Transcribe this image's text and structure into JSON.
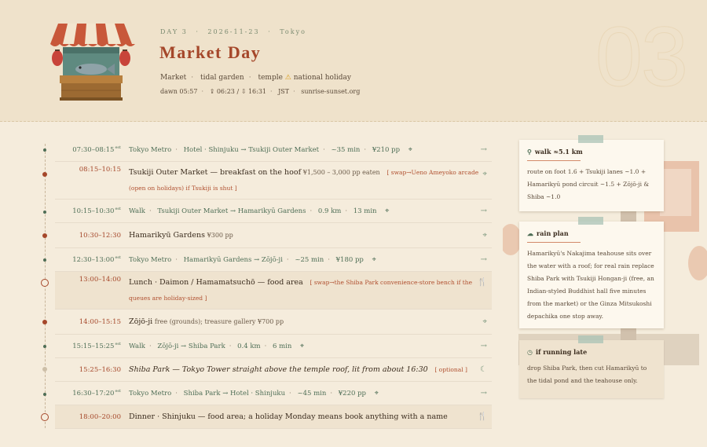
{
  "header": {
    "day_label": "DAY 3",
    "date": "2026-11-23",
    "city": "Tokyo",
    "title": "Market Day",
    "tags": [
      "Market",
      "tidal garden",
      "temple"
    ],
    "holiday_tag": "national holiday",
    "dawn": "dawn 05:57",
    "sunrise": "06:23",
    "sunset": "16:31",
    "tz": "JST",
    "source": "sunrise-sunset.org",
    "day_number": "03"
  },
  "timeline": [
    {
      "kind": "transit",
      "time": "07:30–08:15",
      "tz": "est",
      "mode": "Tokyo Metro",
      "route": "Hotel · Shinjuku → Tsukiji Outer Market",
      "duration": "~35 min",
      "cost": "¥210 pp"
    },
    {
      "kind": "visit",
      "time": "08:15–10:15",
      "title": "Tsukiji Outer Market — breakfast on the hoof",
      "detail": "¥1,500 – 3,000 pp eaten",
      "swap": "[ swap→Ueno Ameyoko arcade (open on holidays) if Tsukiji is shut ]"
    },
    {
      "kind": "transit",
      "time": "10:15–10:30",
      "tz": "est",
      "mode": "Walk",
      "route": "Tsukiji Outer Market → Hamarikyū Gardens",
      "distance": "0.9 km",
      "duration": "13 min"
    },
    {
      "kind": "visit",
      "time": "10:30–12:30",
      "title": "Hamarikyū Gardens",
      "detail": "¥300 pp"
    },
    {
      "kind": "transit",
      "time": "12:30–13:00",
      "tz": "est",
      "mode": "Tokyo Metro",
      "route": "Hamarikyū Gardens → Zōjō-ji",
      "duration": "~25 min",
      "cost": "¥180 pp"
    },
    {
      "kind": "meal",
      "time": "13:00–14:00",
      "title": "Lunch · Daimon / Hamamatsuchō — food area",
      "swap": "[ swap→the Shiba Park convenience-store bench if the queues are holiday-sized ]"
    },
    {
      "kind": "visit",
      "time": "14:00–15:15",
      "title": "Zōjō-ji",
      "detail": "free (grounds); treasure gallery ¥700 pp"
    },
    {
      "kind": "transit",
      "time": "15:15–15:25",
      "tz": "est",
      "mode": "Walk",
      "route": "Zōjō-ji → Shiba Park",
      "distance": "0.4 km",
      "duration": "6 min"
    },
    {
      "kind": "optional",
      "time": "15:25–16:30",
      "title": "Shiba Park — Tokyo Tower straight above the temple roof, lit from about 16:30",
      "swap": "[ optional ]"
    },
    {
      "kind": "transit",
      "time": "16:30–17:20",
      "tz": "est",
      "mode": "Tokyo Metro",
      "route": "Shiba Park → Hotel · Shinjuku",
      "duration": "~45 min",
      "cost": "¥220 pp"
    },
    {
      "kind": "meal",
      "time": "18:00–20:00",
      "title": "Dinner · Shinjuku — food area; a holiday Monday means book anything with a name"
    }
  ],
  "notes": {
    "walk_title": "walk ≈5.1 km",
    "walk_body": "route on foot 1.6 + Tsukiji lanes ~1.0 + Hamarikyū pond circuit ~1.5 + Zōjō-ji & Shiba ~1.0",
    "rain_title": "rain plan",
    "rain_body": "Hamarikyū's Nakajima teahouse sits over the water with a roof; for real rain replace Shiba Park with Tsukiji Hongan-ji (free, an Indian-styled Buddhist hall five minutes from the market) or the Ginza Mitsukoshi depachika one stop away.",
    "late_title": "if running late",
    "late_body": "drop Shiba Park, then cut Hamarikyū to the tidal pond and the teahouse only."
  },
  "colors": {
    "accent": "#a5472a",
    "transit": "#4e6e56",
    "background": "#f5ecdc"
  },
  "icons": {
    "transit_row": "arrow-right-icon",
    "visit_row": "map-pin-icon",
    "meal_row": "utensils-icon",
    "optional_row": "moon-icon"
  }
}
